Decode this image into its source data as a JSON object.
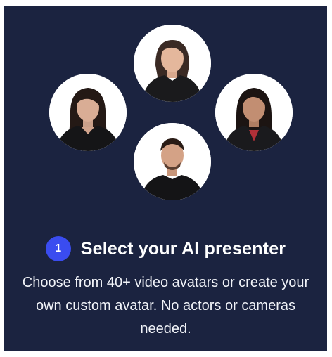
{
  "colors": {
    "background": "#1b2340",
    "step_badge": "#3a4cf0",
    "title_text": "#ffffff",
    "body_text": "#f1f3f8"
  },
  "step": {
    "number": "1",
    "title": "Select your AI presenter",
    "description": "Choose from 40+ video avatars or create your own custom avatar. No actors or cameras needed."
  }
}
